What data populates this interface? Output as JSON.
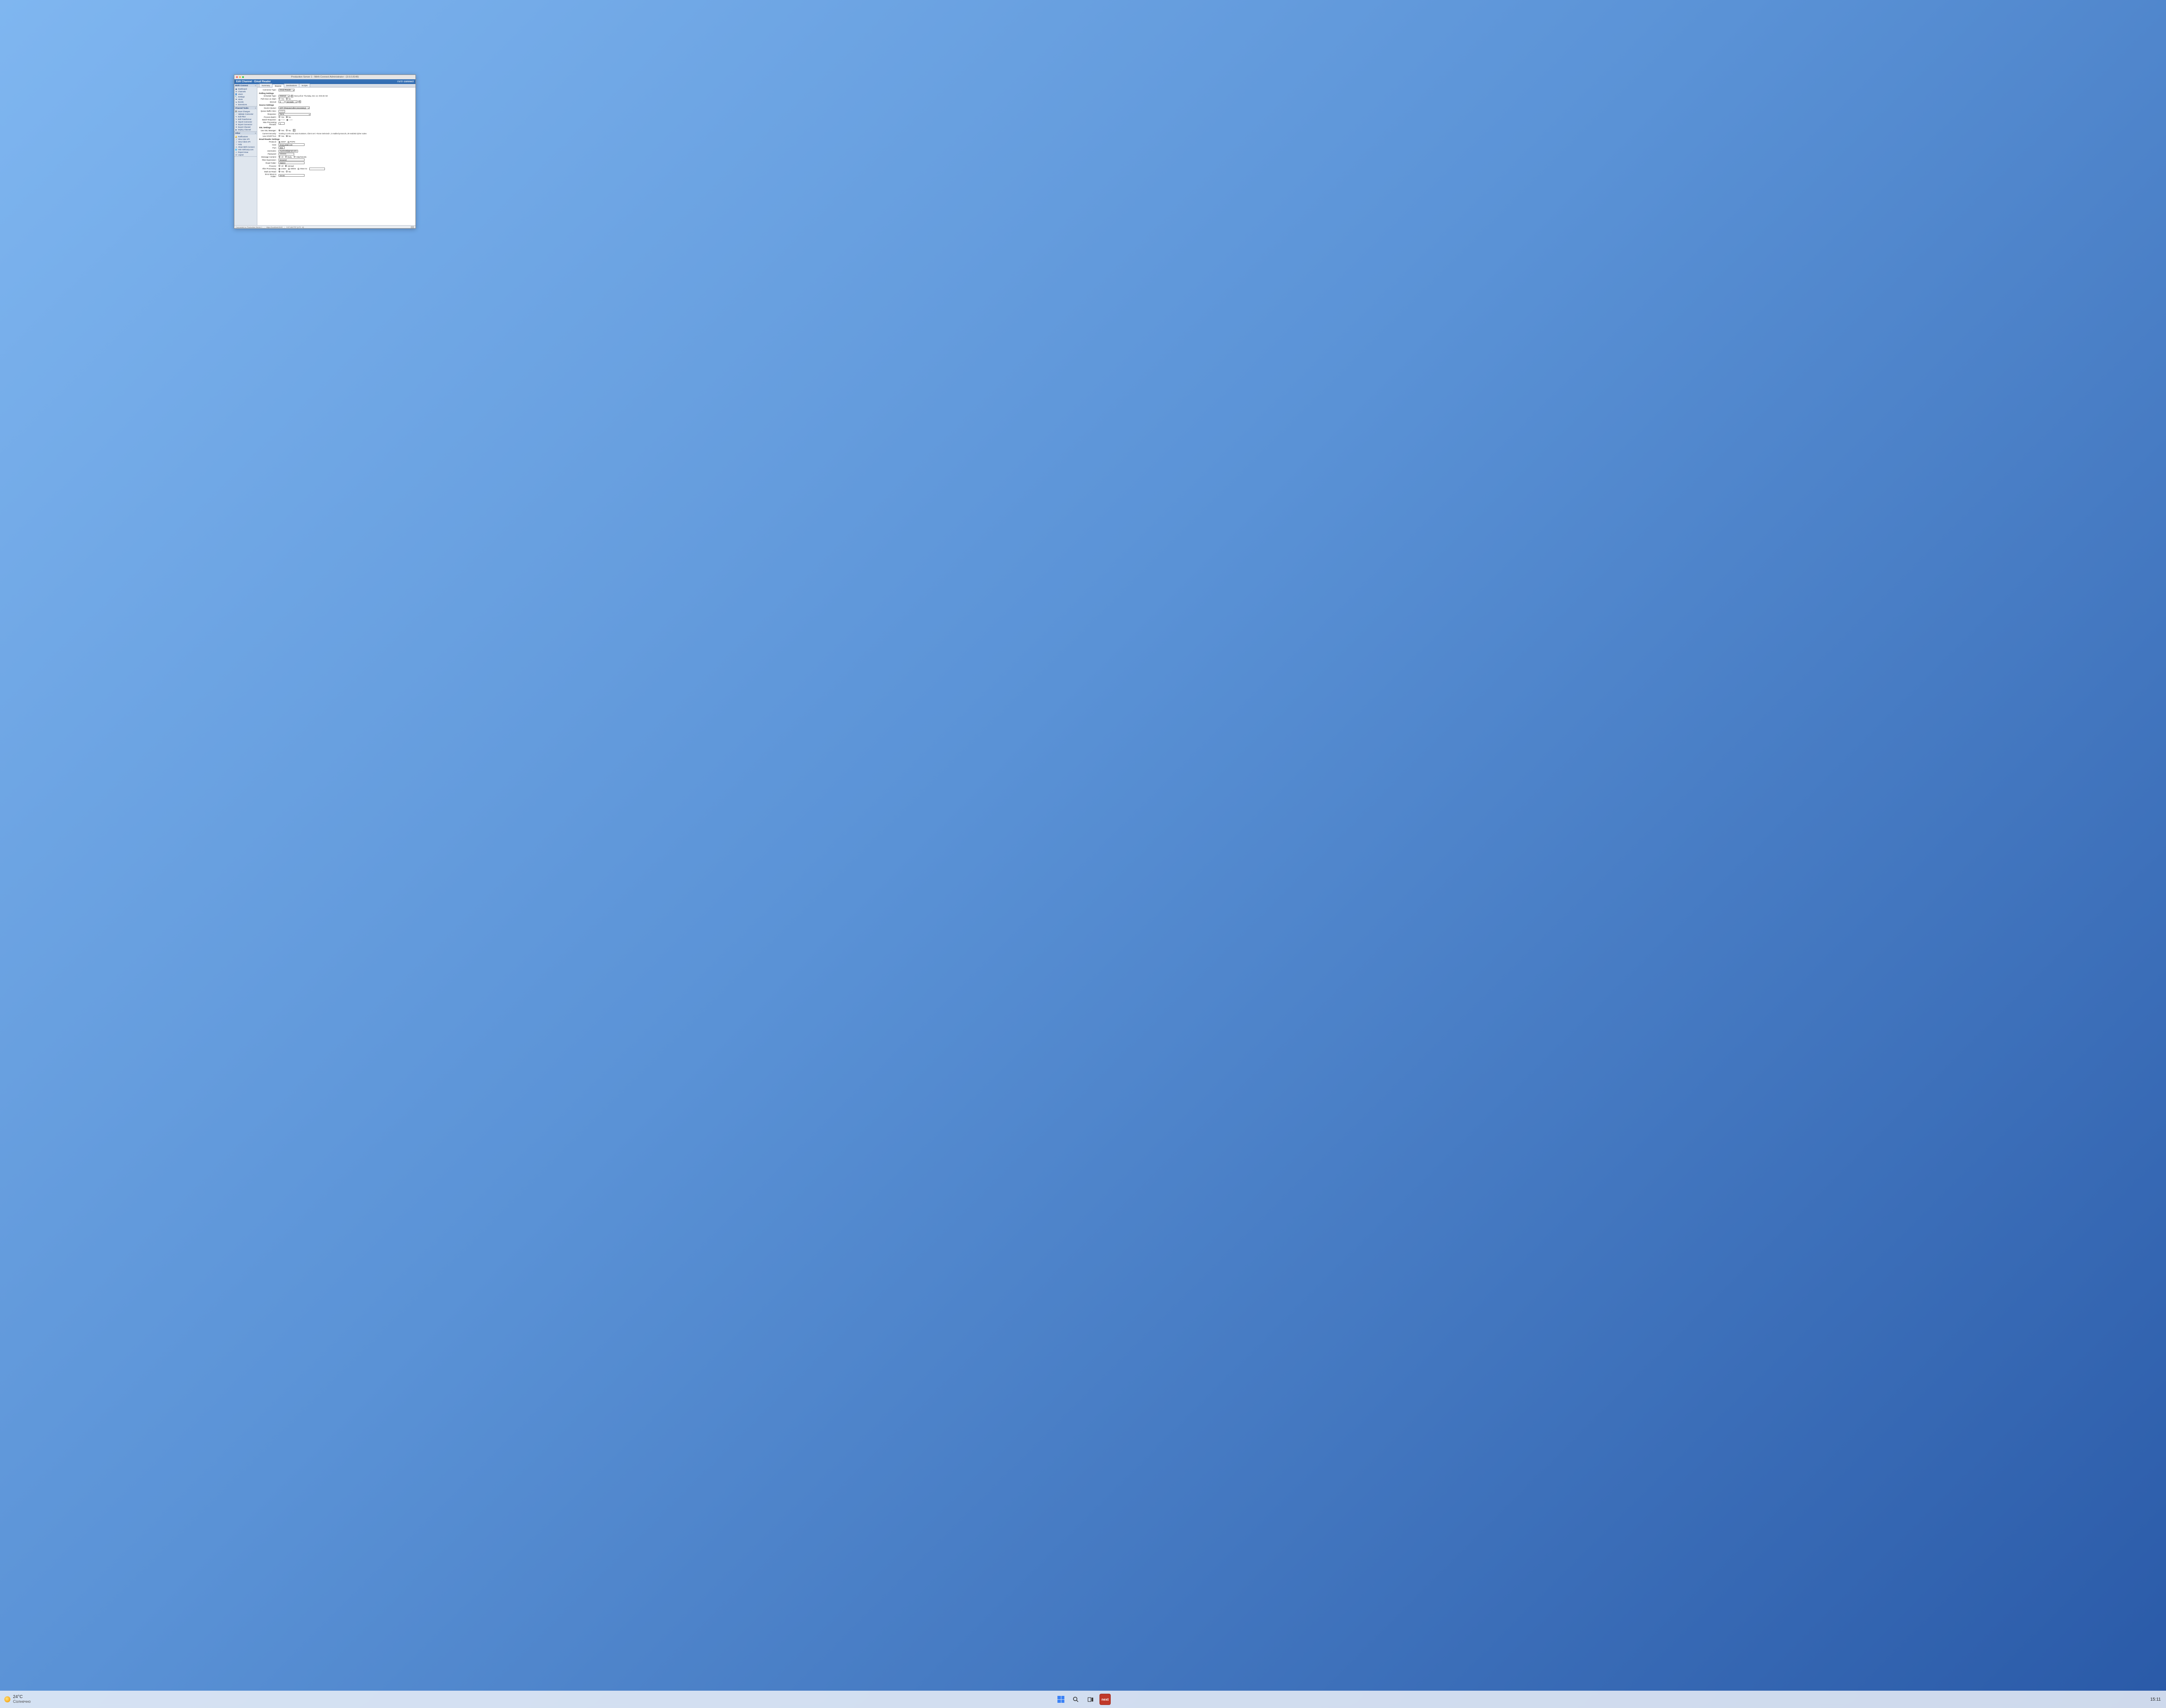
{
  "taskbar": {
    "weather_temp": "24°C",
    "weather_desc": "Солнечно",
    "app_label": "next",
    "clock": "15:11"
  },
  "window": {
    "title": "Production Server 1 - Mirth Connect Administrator - (3.6.0.8149)",
    "header": "Edit Channel - Email Reader",
    "brand_light": "mirth",
    "brand_bold": "connect"
  },
  "sidebar": {
    "panels": [
      {
        "title": "Mirth Connect",
        "items": [
          "Dashboard",
          "Channels",
          "Users",
          "Settings",
          "Alerts",
          "Events",
          "Extensions"
        ]
      },
      {
        "title": "Channel Tasks",
        "items": [
          "Save Changes",
          "Validate Connector",
          "Edit Filter",
          "Edit Transformer",
          "Import Connector",
          "Export Connector",
          "Export Channel",
          "Deploy Channel"
        ]
      },
      {
        "title": "Other",
        "items": [
          "Notifications",
          "View User API",
          "View Client API",
          "Help",
          "About Mirth Connect",
          "Visit mirthcorp.com",
          "Report Issue",
          "Logout"
        ]
      }
    ]
  },
  "tabs": [
    "Summary",
    "Source",
    "Destinations",
    "Scripts"
  ],
  "form": {
    "connector_type_label": "Connector Type:",
    "connector_type_value": "Email Reader",
    "sections": {
      "polling": "Polling Settings",
      "source": "Source Settings",
      "ssl": "SSL Settings",
      "email": "Email Reader Settings"
    },
    "polling": {
      "schedule_type_label": "Schedule Type:",
      "schedule_type_value": "Interval",
      "next_poll": "Next poll at: Thursday, Dec 13, 9:06:30 AM",
      "poll_once_label": "Poll Once on Start:",
      "interval_label": "Interval:",
      "interval_value": "5",
      "interval_unit": "seconds"
    },
    "source": {
      "queue_label": "Source Queue:",
      "queue_value": "OFF (Respond after processing)",
      "batch_size_label": "Queue Buffer Size:",
      "batch_size_value": "1000",
      "response_label": "Response:",
      "response_value": "None",
      "process_batch_label": "Process Batch:",
      "batch_response_label": "Batch Response:",
      "batch_first": "First",
      "batch_last": "Last",
      "threads_label": "Max Processing Threads:",
      "threads_value": "1"
    },
    "ssl": {
      "use_manager_label": "Use SSL Manager:",
      "current_label": "Current Security:",
      "current_value": "Trusting 3 certs and Java truststore, Client cert: <None Selected>, 2 enabled protocols, 29 enabled cipher suites",
      "use_starttls_label": "Use STARTTLS:"
    },
    "email": {
      "protocol_label": "Protocol:",
      "protocol_imap": "IMAP",
      "protocol_pop3": "POP3",
      "host_label": "Host:",
      "host_value": "imap.gmail.com",
      "port_label": "Port:",
      "port_value": "993",
      "username_label": "Username:",
      "username_value": "myemail@gmail.com",
      "password_label": "Password:",
      "password_value": "••••••••••",
      "msg_content_label": "Message Content:",
      "mc_all": "All",
      "mc_body": "Body",
      "mc_attach": "Attachments",
      "filter_label": "Filter Expression:",
      "filter_value": "keyword",
      "read_folder_label": "Read Folder:",
      "read_folder_value": "INBOX",
      "process_label": "Process:",
      "p_all": "All",
      "p_unread": "Unread",
      "after_label": "After Processing:",
      "a_leave": "Leave",
      "a_delete": "Delete",
      "a_move": "Move to:",
      "mark_read_label": "Mark as Read:",
      "error_folder_label": "Error Move-to Folder:",
      "error_folder_value": "Errors"
    },
    "yes": "Yes",
    "no": "No"
  },
  "status": {
    "connected": "Connected to: Production Server 1",
    "url": "https://localhost:8443",
    "time": "9:07 AM PST (UTC -8)"
  }
}
